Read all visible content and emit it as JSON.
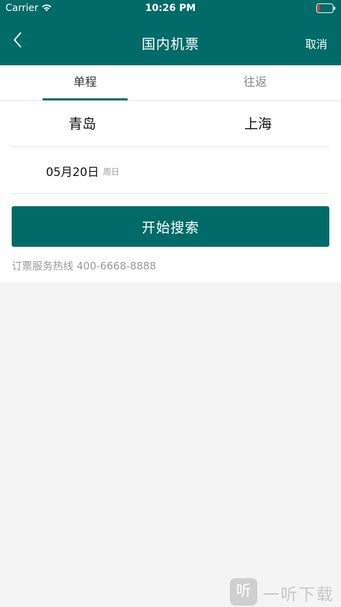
{
  "status_bar": {
    "carrier": "Carrier",
    "time": "10:26 PM",
    "wifi_icon": "wifi-icon",
    "battery_icon": "battery-icon"
  },
  "nav": {
    "back_icon": "chevron-left-icon",
    "title": "国内机票",
    "cancel_label": "取消"
  },
  "tabs": [
    {
      "label": "单程",
      "active": true
    },
    {
      "label": "往返",
      "active": false
    }
  ],
  "route": {
    "from_city": "青岛",
    "to_city": "上海"
  },
  "date": {
    "main": "05月20日",
    "weekday": "周日"
  },
  "search_button": {
    "label": "开始搜索"
  },
  "hotline": "订票服务热线 400-6668-8888",
  "watermark": {
    "logo_text": "听",
    "text": "一听下载"
  },
  "colors": {
    "primary": "#006b68",
    "background": "#f4f4f4",
    "card": "#ffffff",
    "muted_text": "#999999"
  }
}
